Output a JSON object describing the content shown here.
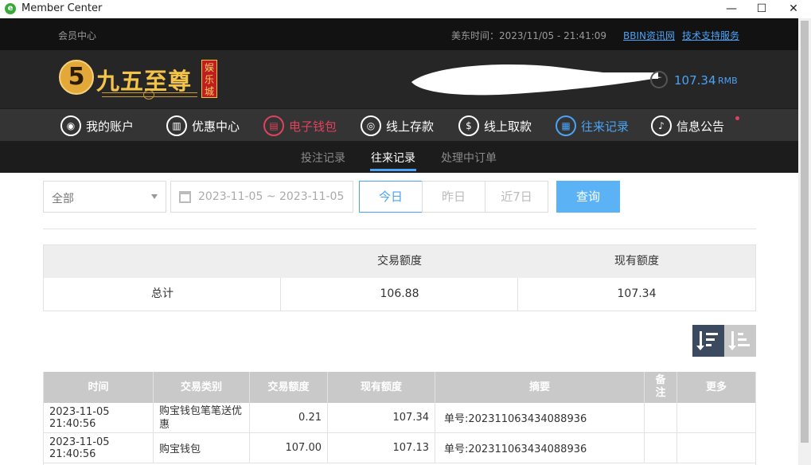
{
  "window": {
    "title": "Member Center",
    "controls": [
      "—",
      "☐",
      "✕"
    ]
  },
  "topbar": {
    "title": "会员中心",
    "time_label": "美东时间：2023/11/05 - 21:41:09",
    "links": [
      "BBIN资讯网",
      "技术支持服务"
    ]
  },
  "header": {
    "logo_text": "九五至尊",
    "logo_badge": "娱乐城",
    "balance": "107.34",
    "currency": "RMB"
  },
  "nav": {
    "items": [
      "我的账户",
      "优惠中心",
      "电子钱包",
      "线上存款",
      "线上取款",
      "往来记录",
      "信息公告"
    ]
  },
  "subnav": {
    "items": [
      "投注记录",
      "往来记录",
      "处理中订单"
    ]
  },
  "filter": {
    "type_value": "全部",
    "date_range": "2023-11-05 ~ 2023-11-05",
    "quick": [
      "今日",
      "昨日",
      "近7日"
    ],
    "query_label": "查询"
  },
  "summary": {
    "headers": [
      "交易额度",
      "现有额度"
    ],
    "row_label": "总计",
    "trade_total": "106.88",
    "balance_total": "107.34"
  },
  "table": {
    "headers": [
      "时间",
      "交易类别",
      "交易额度",
      "现有额度",
      "摘要",
      "备注",
      "更多"
    ],
    "rows": [
      {
        "time": "2023-11-05 21:40:56",
        "type": "购宝钱包笔笔送优惠",
        "amount": "0.21",
        "balance": "107.34",
        "summary": "单号:202311063434088936",
        "note": "",
        "more": ""
      },
      {
        "time": "2023-11-05 21:40:56",
        "type": "购宝钱包",
        "amount": "107.00",
        "balance": "107.13",
        "summary": "单号:202311063434088936",
        "note": "",
        "more": ""
      }
    ]
  },
  "colors": {
    "accent_blue": "#4aa3f5",
    "accent_red": "#e0425b",
    "header_bg": "#262626",
    "nav_bg": "#343434"
  }
}
